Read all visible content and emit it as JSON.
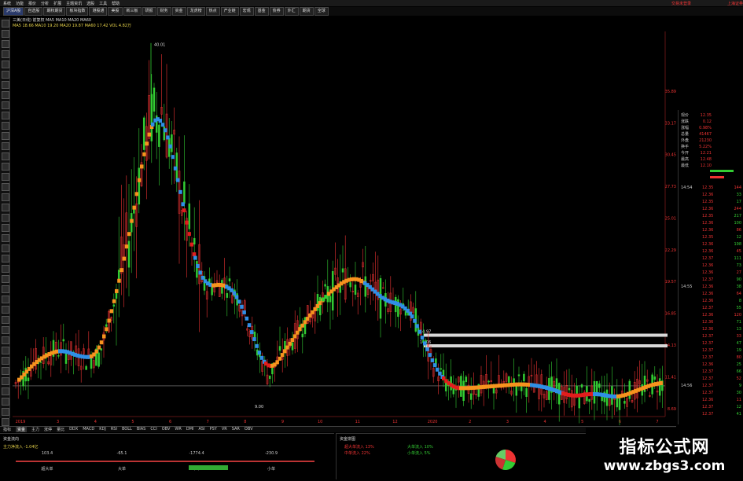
{
  "menubar": {
    "items": [
      "系统",
      "功能",
      "报价",
      "分析",
      "扩展",
      "主题资讯",
      "选股",
      "工具",
      "帮助"
    ],
    "right": [
      "交易未登录",
      "上海证券"
    ]
  },
  "tabs": [
    "沪深A股",
    "自选股",
    "期权期货",
    "板块指数",
    "港股通",
    "美股",
    "新三板",
    "研报",
    "财务",
    "资金",
    "龙虎榜",
    "热点",
    "产业链",
    "宏观",
    "基金",
    "债券",
    "外汇",
    "期货",
    "全球"
  ],
  "header": {
    "line1": "三美(日线) 前复权  MA5 MA10 MA20 MA60",
    "line2": "MA5 18.66  MA10 19.20  MA20 19.87  MA60 17.42  VOL 4.82万"
  },
  "chart_data": {
    "type": "candlestick",
    "price_axis": {
      "labels": [
        "35.89",
        "33.17",
        "30.45",
        "27.73",
        "25.01",
        "22.29",
        "19.57",
        "16.85",
        "14.13",
        "11.41",
        "8.69"
      ]
    },
    "high_label": "40.01",
    "low_label": "9.00",
    "peak_annotation": "40.01",
    "level_lines": [
      {
        "label": "14.97",
        "value": 14.97
      },
      {
        "label": "14.06",
        "value": 14.06
      },
      {
        "label": "10.63",
        "value": 10.63
      }
    ],
    "time_labels": [
      "2019",
      "3",
      "4",
      "5",
      "6",
      "7",
      "8",
      "9",
      "10",
      "11",
      "12",
      "2020",
      "2",
      "3",
      "4",
      "5",
      "6",
      "7"
    ]
  },
  "right_panel": {
    "quote": [
      {
        "k": "现价",
        "v": "12.35"
      },
      {
        "k": "涨跌",
        "v": "0.12"
      },
      {
        "k": "涨幅",
        "v": "0.98%"
      },
      {
        "k": "总量",
        "v": "41467"
      },
      {
        "k": "外盘",
        "v": "21230"
      },
      {
        "k": "换手",
        "v": "5.22%"
      },
      {
        "k": "今开",
        "v": "12.21"
      },
      {
        "k": "最高",
        "v": "12.48"
      },
      {
        "k": "最低",
        "v": "12.10"
      }
    ],
    "times": [
      "14:54",
      "14:55",
      "14:56"
    ],
    "ticks": [
      "12.35",
      "12.36",
      "12.35",
      "12.36",
      "12.35",
      "12.36",
      "12.36",
      "12.35",
      "12.36",
      "12.36",
      "12.37",
      "12.36",
      "12.36",
      "12.37",
      "12.36",
      "12.36",
      "12.36",
      "12.37",
      "12.36",
      "12.36",
      "12.36",
      "12.37",
      "12.37",
      "12.37",
      "12.37",
      "12.36",
      "12.37",
      "12.37",
      "12.37",
      "12.37",
      "12.36",
      "12.37",
      "12.37"
    ],
    "vols": [
      "144",
      "33",
      "17",
      "244",
      "217",
      "100",
      "86",
      "12",
      "198",
      "45",
      "111",
      "73",
      "27",
      "90",
      "38",
      "64",
      "8",
      "55",
      "120",
      "71",
      "13",
      "33",
      "47",
      "19",
      "80",
      "25",
      "66",
      "52",
      "9",
      "30",
      "11",
      "12",
      "41"
    ]
  },
  "bottom_tabs": [
    "指标",
    "资金",
    "主力",
    "涨停",
    "量比",
    "DDX",
    "MACD",
    "KDJ",
    "RSI",
    "BOLL",
    "BIAS",
    "CCI",
    "OBV",
    "WR",
    "DMI",
    "ASI",
    "PSY",
    "VR",
    "SAR",
    "OBV"
  ],
  "fund_panel": {
    "title": "资金流向",
    "labels": [
      "超大单",
      "大单",
      "中单",
      "小单"
    ],
    "values": [
      "103.4",
      "-65.1",
      "-1774.4",
      "-230.9"
    ],
    "sub": [
      "主力净流入",
      "-1.04亿"
    ]
  },
  "fund_panel2": {
    "title": "资金饼图",
    "rows": [
      "超大单流入 13%",
      "大单流入 10%",
      "中单流入 22%",
      "小单流入 5%"
    ]
  },
  "watermark": {
    "line1": "指标公式网",
    "line2": "www.zbgs3.com"
  },
  "colors": {
    "up": "#e33",
    "down": "#3c3",
    "orange": "#f7931e",
    "blue": "#2f8fe6",
    "red": "#e21d1d"
  }
}
